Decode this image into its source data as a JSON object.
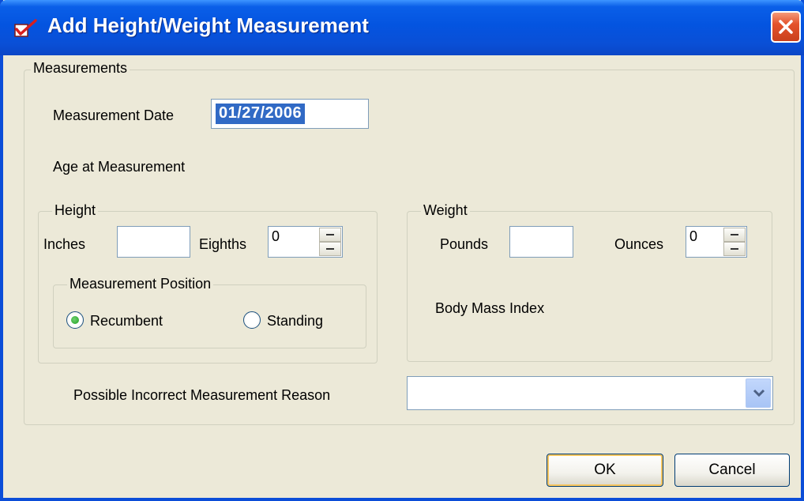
{
  "window": {
    "title": "Add Height/Weight Measurement"
  },
  "measurements": {
    "group_title": "Measurements",
    "date_label": "Measurement Date",
    "date_value": "01/27/2006",
    "age_label": "Age at Measurement"
  },
  "height": {
    "group_title": "Height",
    "inches_label": "Inches",
    "inches_value": "",
    "eighths_label": "Eighths",
    "eighths_value": "0",
    "position": {
      "group_title": "Measurement Position",
      "options": [
        {
          "label": "Recumbent",
          "selected": true
        },
        {
          "label": "Standing",
          "selected": false
        }
      ]
    }
  },
  "weight": {
    "group_title": "Weight",
    "pounds_label": "Pounds",
    "pounds_value": "",
    "ounces_label": "Ounces",
    "ounces_value": "0",
    "bmi_label": "Body Mass Index"
  },
  "reason": {
    "label": "Possible Incorrect Measurement Reason",
    "selected_value": ""
  },
  "buttons": {
    "ok": "OK",
    "cancel": "Cancel"
  },
  "colors": {
    "titlebar": "#0454e0",
    "selection": "#316ac5",
    "dialog_bg": "#ece9d8",
    "close_button": "#e4532c",
    "radio_dot": "#21a121"
  },
  "icons": {
    "title": "checkmark-app-icon",
    "close": "close-icon",
    "dropdown": "chevron-down-icon"
  }
}
